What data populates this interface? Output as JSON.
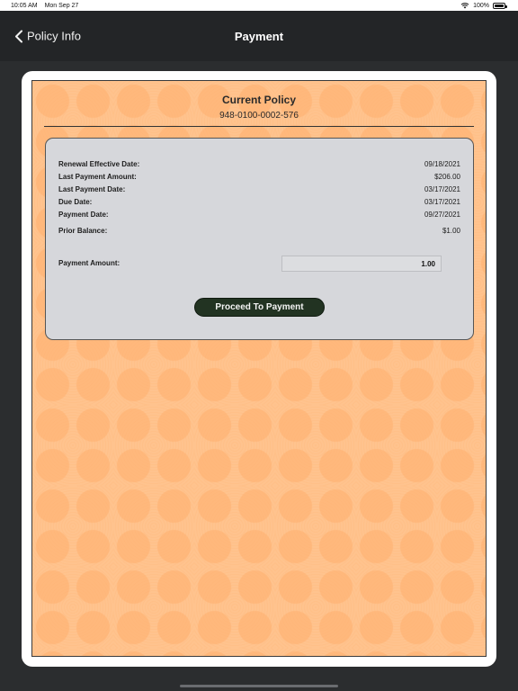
{
  "status_bar": {
    "time": "10:05 AM",
    "date": "Mon Sep 27",
    "battery_percent": "100%",
    "icons": [
      "wifi-icon",
      "battery-icon"
    ]
  },
  "nav": {
    "back_label": "Policy Info",
    "title": "Payment",
    "back_icon": "chevron-left-icon"
  },
  "policy": {
    "title": "Current Policy",
    "number": "948-0100-0002-576"
  },
  "details": [
    {
      "label": "Renewal Effective Date:",
      "value": "09/18/2021"
    },
    {
      "label": "Last Payment Amount:",
      "value": "$206.00"
    },
    {
      "label": "Last Payment Date:",
      "value": "03/17/2021"
    },
    {
      "label": "Due Date:",
      "value": "03/17/2021"
    },
    {
      "label": "Payment Date:",
      "value": "09/27/2021"
    },
    {
      "label": "Prior Balance:",
      "value": "$1.00"
    }
  ],
  "payment": {
    "label": "Payment Amount:",
    "value": "1.00",
    "button_label": "Proceed To Payment"
  },
  "colors": {
    "nav_background": "#232527",
    "card_background": "#ffc38e",
    "panel_background": "#d6d7db",
    "button_background": "#223322"
  }
}
